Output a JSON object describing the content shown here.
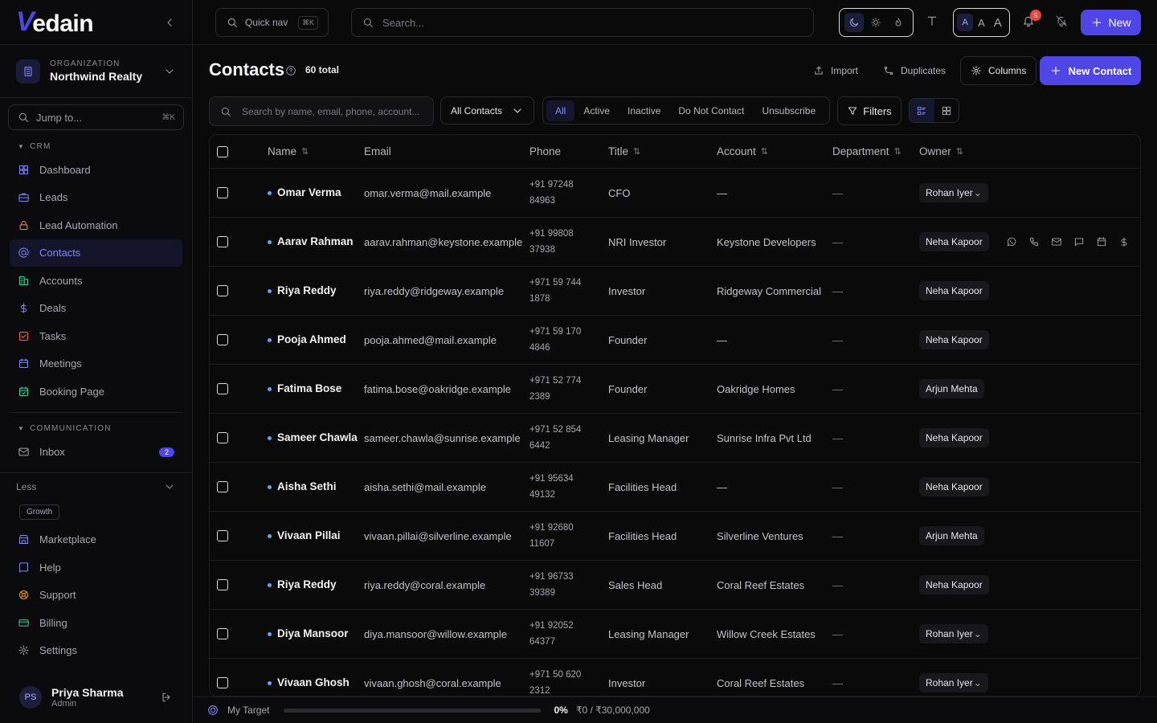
{
  "sidebar": {
    "logo_letter": "V",
    "logo_text": "edain",
    "org_label": "ORGANIZATION",
    "org_name": "Northwind Realty",
    "jump_placeholder": "Jump to...",
    "jump_shortcut": "⌘K",
    "crm_title": "CRM",
    "crm_items": [
      {
        "label": "Dashboard",
        "icon": "grid-icon"
      },
      {
        "label": "Leads",
        "icon": "briefcase-icon"
      },
      {
        "label": "Lead Automation",
        "icon": "lock-icon"
      },
      {
        "label": "Contacts",
        "icon": "at-icon",
        "active": true
      },
      {
        "label": "Accounts",
        "icon": "building-icon"
      },
      {
        "label": "Deals",
        "icon": "dollar-icon"
      },
      {
        "label": "Tasks",
        "icon": "checkbox-icon"
      },
      {
        "label": "Meetings",
        "icon": "calendar-icon"
      },
      {
        "label": "Booking Page",
        "icon": "calendar-check-icon"
      }
    ],
    "comm_title": "COMMUNICATION",
    "comm_items": [
      {
        "label": "Inbox",
        "icon": "mail-icon",
        "badge": "2"
      }
    ],
    "less_label": "Less",
    "growth_label": "Growth",
    "bottom_items": [
      {
        "label": "Marketplace",
        "icon": "store-icon"
      },
      {
        "label": "Help",
        "icon": "book-icon"
      },
      {
        "label": "Support",
        "icon": "lifebuoy-icon"
      },
      {
        "label": "Billing",
        "icon": "card-icon"
      },
      {
        "label": "Settings",
        "icon": "gear-icon"
      }
    ],
    "user": {
      "initials": "PS",
      "name": "Priya Sharma",
      "role": "Admin"
    }
  },
  "topbar": {
    "quicknav_label": "Quick nav",
    "quicknav_shortcut": "⌘K",
    "search_placeholder": "Search...",
    "font_sizes": [
      "A",
      "A",
      "A"
    ],
    "notif_count": "5",
    "new_label": "New"
  },
  "page": {
    "title": "Contacts",
    "total": "60 total",
    "import_label": "Import",
    "duplicates_label": "Duplicates",
    "columns_label": "Columns",
    "new_contact_label": "New Contact",
    "filter_search_placeholder": "Search by name, email, phone, account...",
    "view_select": "All Contacts",
    "status_tabs": [
      "All",
      "Active",
      "Inactive",
      "Do Not Contact",
      "Unsubscribe"
    ],
    "filters_label": "Filters"
  },
  "table": {
    "headers": {
      "name": "Name",
      "email": "Email",
      "phone": "Phone",
      "title": "Title",
      "account": "Account",
      "department": "Department",
      "owner": "Owner"
    },
    "rows": [
      {
        "name": "Omar Verma",
        "email": "omar.verma@mail.example",
        "phone1": "+91 97248",
        "phone2": "84963",
        "title": "CFO",
        "account": "—",
        "department": "—",
        "owner": "Rohan Iyer"
      },
      {
        "name": "Aarav Rahman",
        "email": "aarav.rahman@keystone.example",
        "phone1": "+91 99808",
        "phone2": "37938",
        "title": "NRI Investor",
        "account": "Keystone Developers",
        "department": "—",
        "owner": "Neha Kapoor"
      },
      {
        "name": "Riya Reddy",
        "email": "riya.reddy@ridgeway.example",
        "phone1": "+971 59 744",
        "phone2": "1878",
        "title": "Investor",
        "account": "Ridgeway Commercial",
        "department": "—",
        "owner": "Neha Kapoor"
      },
      {
        "name": "Pooja Ahmed",
        "email": "pooja.ahmed@mail.example",
        "phone1": "+971 59 170",
        "phone2": "4846",
        "title": "Founder",
        "account": "—",
        "department": "—",
        "owner": "Neha Kapoor"
      },
      {
        "name": "Fatima Bose",
        "email": "fatima.bose@oakridge.example",
        "phone1": "+971 52 774",
        "phone2": "2389",
        "title": "Founder",
        "account": "Oakridge Homes",
        "department": "—",
        "owner": "Arjun Mehta"
      },
      {
        "name": "Sameer Chawla",
        "email": "sameer.chawla@sunrise.example",
        "phone1": "+971 52 854",
        "phone2": "6442",
        "title": "Leasing Manager",
        "account": "Sunrise Infra Pvt Ltd",
        "department": "—",
        "owner": "Neha Kapoor"
      },
      {
        "name": "Aisha Sethi",
        "email": "aisha.sethi@mail.example",
        "phone1": "+91 95634",
        "phone2": "49132",
        "title": "Facilities Head",
        "account": "—",
        "department": "—",
        "owner": "Neha Kapoor"
      },
      {
        "name": "Vivaan Pillai",
        "email": "vivaan.pillai@silverline.example",
        "phone1": "+91 92680",
        "phone2": "11607",
        "title": "Facilities Head",
        "account": "Silverline Ventures",
        "department": "—",
        "owner": "Arjun Mehta"
      },
      {
        "name": "Riya Reddy",
        "email": "riya.reddy@coral.example",
        "phone1": "+91 96733",
        "phone2": "39389",
        "title": "Sales Head",
        "account": "Coral Reef Estates",
        "department": "—",
        "owner": "Neha Kapoor"
      },
      {
        "name": "Diya Mansoor",
        "email": "diya.mansoor@willow.example",
        "phone1": "+91 92052",
        "phone2": "64377",
        "title": "Leasing Manager",
        "account": "Willow Creek Estates",
        "department": "—",
        "owner": "Rohan Iyer"
      },
      {
        "name": "Vivaan Ghosh",
        "email": "vivaan.ghosh@coral.example",
        "phone1": "+971 50 620",
        "phone2": "2312",
        "title": "Investor",
        "account": "Coral Reef Estates",
        "department": "—",
        "owner": "Rohan Iyer"
      }
    ],
    "hover_row_actions": [
      "whatsapp-icon",
      "phone-icon",
      "mail-icon",
      "message-icon",
      "calendar-icon",
      "dollar-icon"
    ]
  },
  "target": {
    "label": "My Target",
    "percent": "0%",
    "progress_fraction": 0,
    "amount": "₹0 / ₹30,000,000"
  },
  "colors": {
    "accent": "#4f46e5",
    "background": "#0a0a0b",
    "notification": "#ef4444"
  }
}
